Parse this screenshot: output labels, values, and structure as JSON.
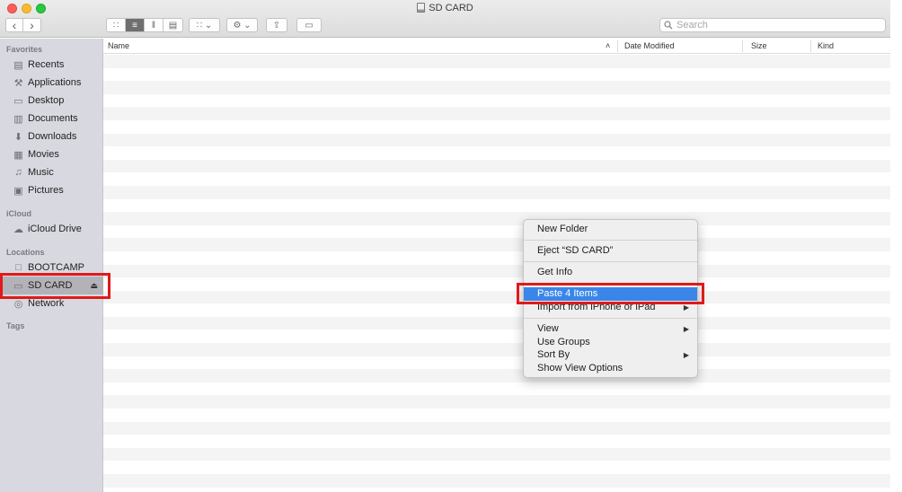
{
  "window": {
    "title": "SD CARD"
  },
  "toolbar": {
    "back": "‹",
    "forward": "›",
    "view_icons": "∷",
    "view_list": "≡",
    "view_columns": "‖",
    "view_gallery": "▤",
    "group": "∷ ⌄",
    "action": "⚙ ⌄",
    "share": "⇧",
    "tag": "▭",
    "search_placeholder": "Search"
  },
  "sidebar": {
    "favorites_heading": "Favorites",
    "favorites": [
      {
        "label": "Recents",
        "icon": "recents-icon",
        "glyph": "▤"
      },
      {
        "label": "Applications",
        "icon": "applications-icon",
        "glyph": "⚒"
      },
      {
        "label": "Desktop",
        "icon": "desktop-icon",
        "glyph": "▭"
      },
      {
        "label": "Documents",
        "icon": "documents-icon",
        "glyph": "▥"
      },
      {
        "label": "Downloads",
        "icon": "downloads-icon",
        "glyph": "⬇"
      },
      {
        "label": "Movies",
        "icon": "movies-icon",
        "glyph": "▦"
      },
      {
        "label": "Music",
        "icon": "music-icon",
        "glyph": "♫"
      },
      {
        "label": "Pictures",
        "icon": "pictures-icon",
        "glyph": "▣"
      }
    ],
    "icloud_heading": "iCloud",
    "icloud": [
      {
        "label": "iCloud Drive",
        "icon": "cloud-icon",
        "glyph": "☁"
      }
    ],
    "locations_heading": "Locations",
    "locations": [
      {
        "label": "BOOTCAMP",
        "icon": "drive-icon",
        "glyph": "□"
      },
      {
        "label": "SD CARD",
        "icon": "drive-icon",
        "glyph": "▭",
        "eject": "⏏"
      },
      {
        "label": "Network",
        "icon": "network-icon",
        "glyph": "◎"
      }
    ],
    "tags_heading": "Tags"
  },
  "columns": {
    "name": "Name",
    "sort_indicator": "˄",
    "date_modified": "Date Modified",
    "size": "Size",
    "kind": "Kind"
  },
  "context_menu": {
    "new_folder": "New Folder",
    "eject": "Eject “SD CARD”",
    "get_info": "Get Info",
    "paste": "Paste 4 Items",
    "import": "Import from iPhone or iPad",
    "view": "View",
    "use_groups": "Use Groups",
    "sort_by": "Sort By",
    "show_view_options": "Show View Options",
    "submenu_arrow": "▶"
  },
  "colors": {
    "highlight": "#3a86e8",
    "annotation_box": "#e01a1a",
    "sidebar_bg": "#d8d8e0"
  }
}
